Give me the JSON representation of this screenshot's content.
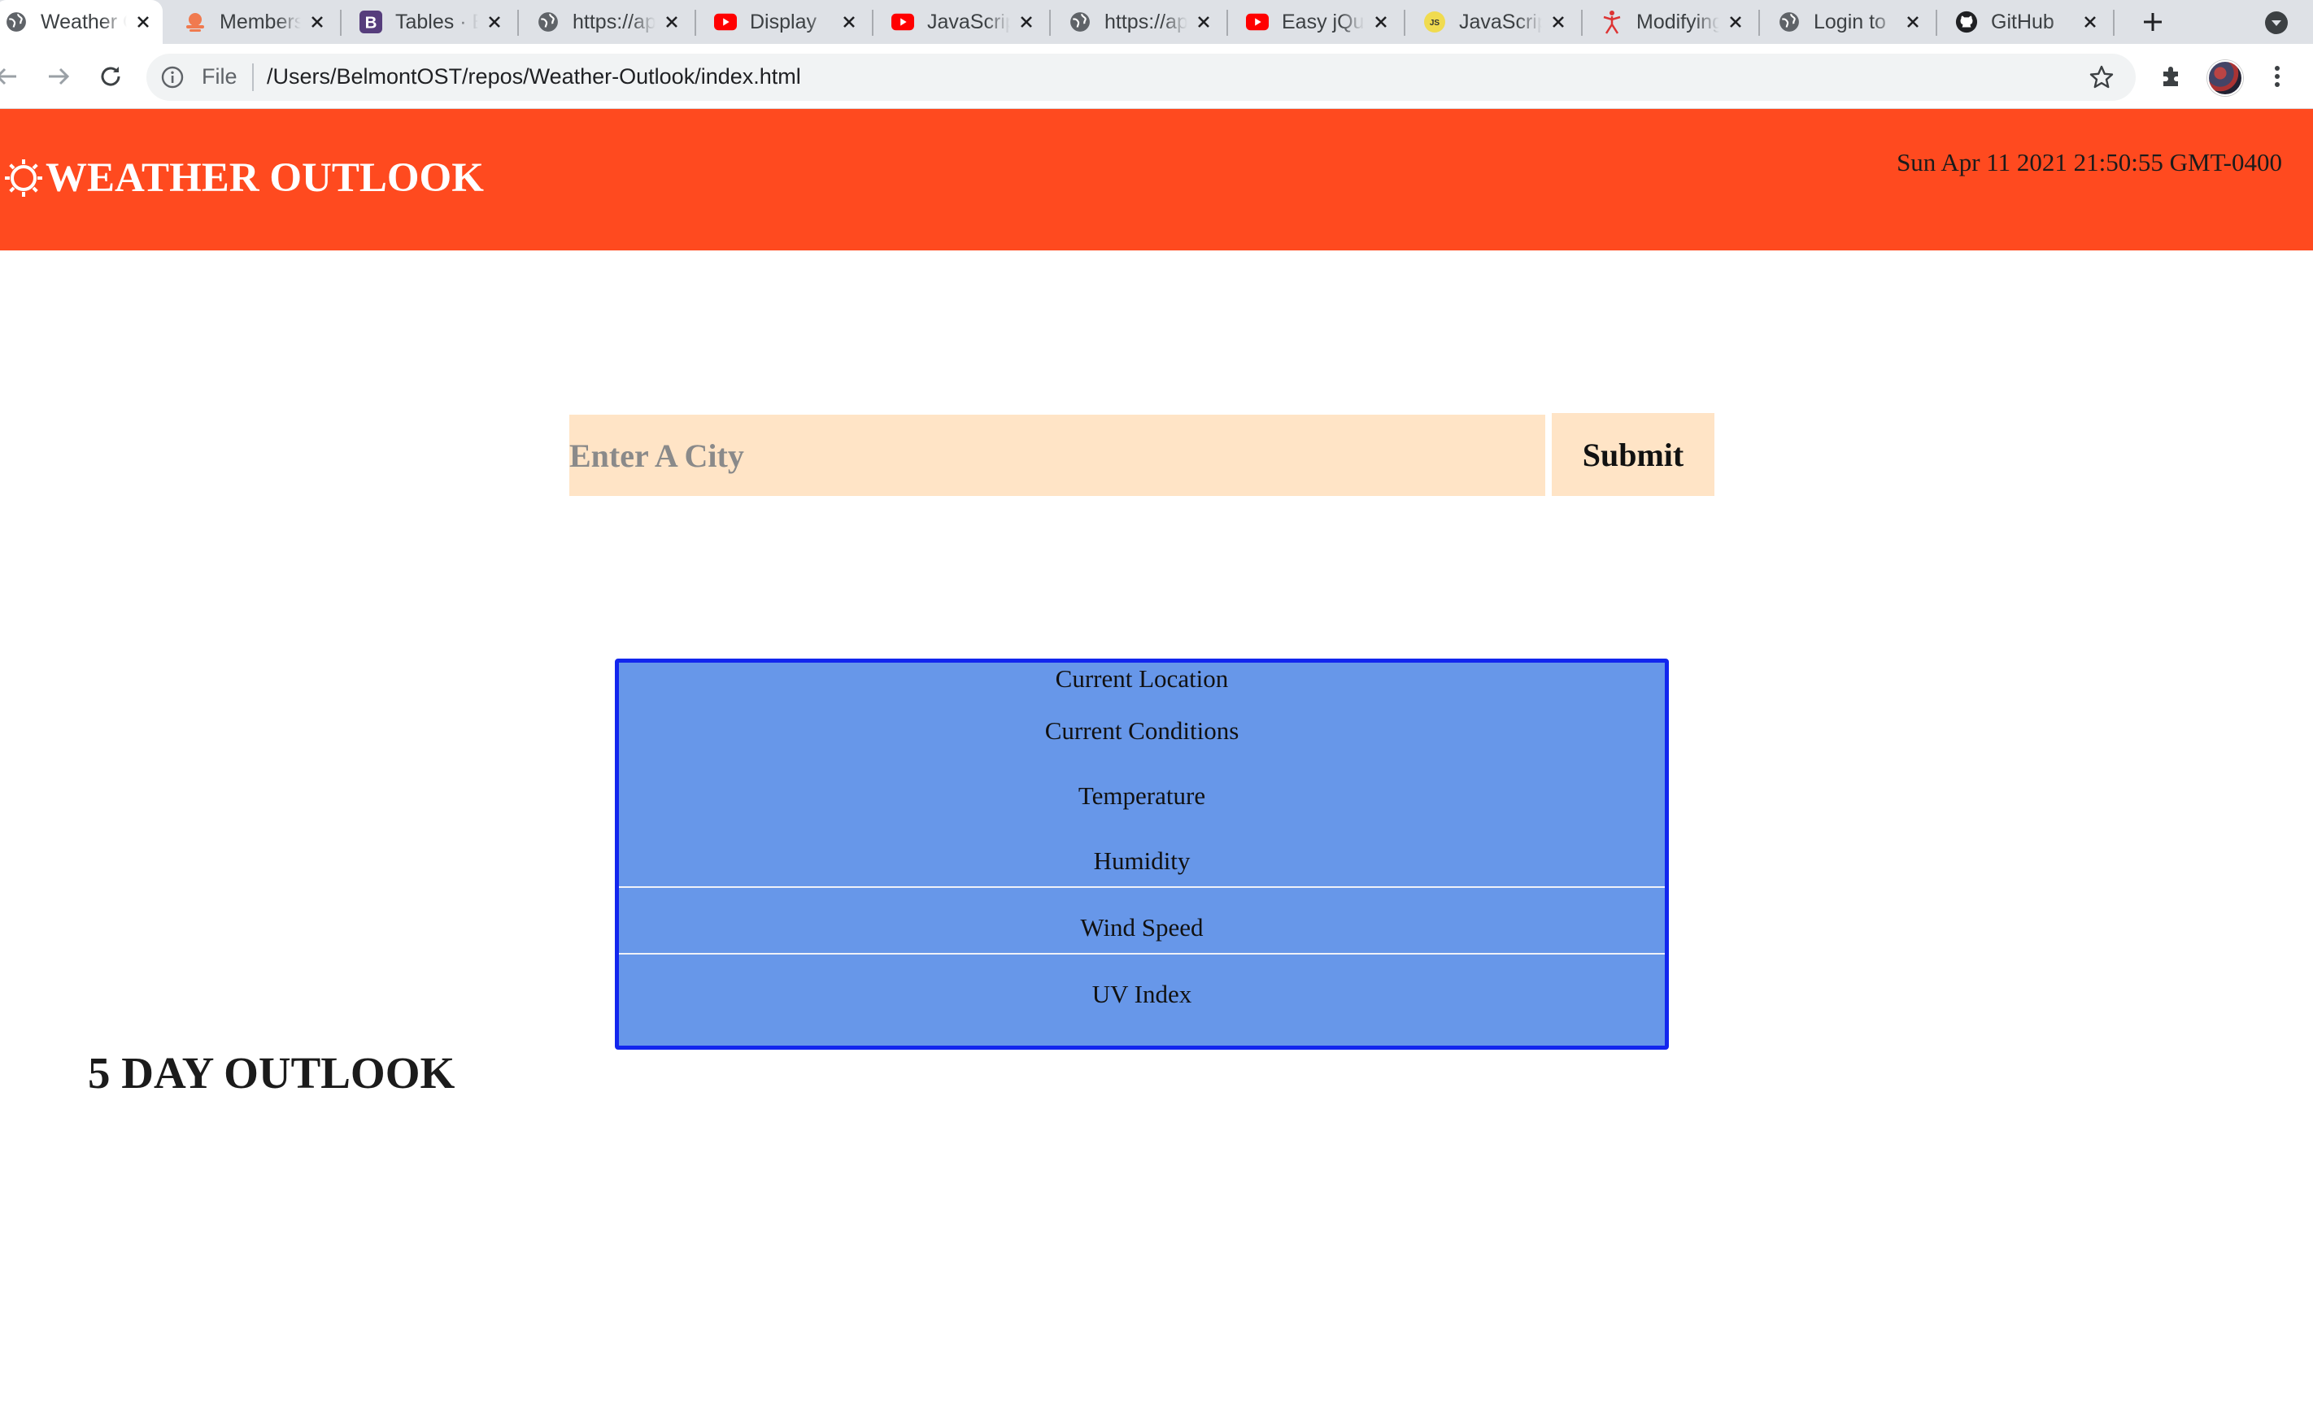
{
  "browser": {
    "tabs": [
      {
        "title": "Weather Outlook",
        "icon": "globe-icon",
        "active": true
      },
      {
        "title": "Members",
        "icon": "cloud-sun-icon",
        "active": false
      },
      {
        "title": "Tables · Bootstrap",
        "icon": "bootstrap-icon",
        "active": false
      },
      {
        "title": "https://api",
        "icon": "globe-icon",
        "active": false
      },
      {
        "title": "Display",
        "icon": "youtube-icon",
        "active": false
      },
      {
        "title": "JavaScript",
        "icon": "youtube-icon",
        "active": false
      },
      {
        "title": "https://api",
        "icon": "globe-icon",
        "active": false
      },
      {
        "title": "Easy jQuery",
        "icon": "youtube-icon",
        "active": false
      },
      {
        "title": "JavaScript",
        "icon": "js-icon",
        "active": false
      },
      {
        "title": "Modifying",
        "icon": "figure-icon",
        "active": false
      },
      {
        "title": "Login to",
        "icon": "globe-icon",
        "active": false
      },
      {
        "title": "GitHub",
        "icon": "github-icon",
        "active": false
      }
    ],
    "omnibox": {
      "scheme_label": "File",
      "url": "/Users/BelmontOST/repos/Weather-Outlook/index.html"
    }
  },
  "header": {
    "title": "WEATHER OUTLOOK",
    "datetime": "Sun Apr 11 2021 21:50:55 GMT-0400",
    "background_color": "#ff4a1f"
  },
  "search": {
    "placeholder": "Enter A City",
    "value": "",
    "submit_label": "Submit"
  },
  "current_weather": {
    "location": "Current Location",
    "conditions": "Current Conditions",
    "temperature": "Temperature",
    "humidity": "Humidity",
    "wind_speed": "Wind Speed",
    "uv_index": "UV Index",
    "panel_color": "#6797e9",
    "border_color": "#1226ee"
  },
  "forecast": {
    "heading": "5 DAY OUTLOOK"
  }
}
